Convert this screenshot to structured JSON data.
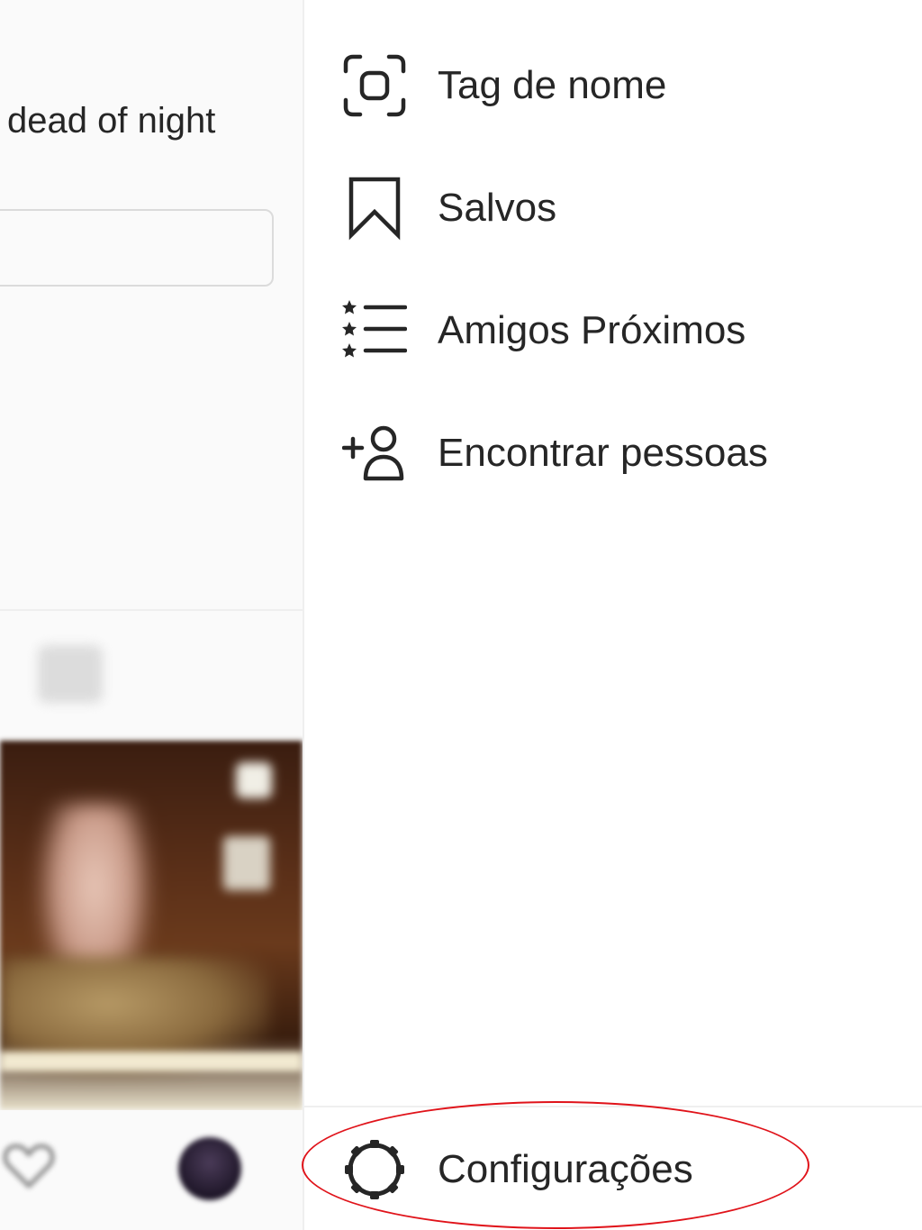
{
  "profile": {
    "bio_fragment": "dead of night"
  },
  "drawer": {
    "items": [
      {
        "label": "Tag de nome",
        "icon": "nametag-icon"
      },
      {
        "label": "Salvos",
        "icon": "bookmark-icon"
      },
      {
        "label": "Amigos Próximos",
        "icon": "close-friends-list-icon"
      },
      {
        "label": "Encontrar pessoas",
        "icon": "add-person-icon"
      }
    ],
    "settings": {
      "label": "Configurações",
      "icon": "gear-icon"
    }
  },
  "annotation": {
    "color": "#e0131a",
    "target": "settings"
  },
  "colors": {
    "text": "#262626",
    "divider": "#efefef",
    "background_left": "#fafafa"
  }
}
